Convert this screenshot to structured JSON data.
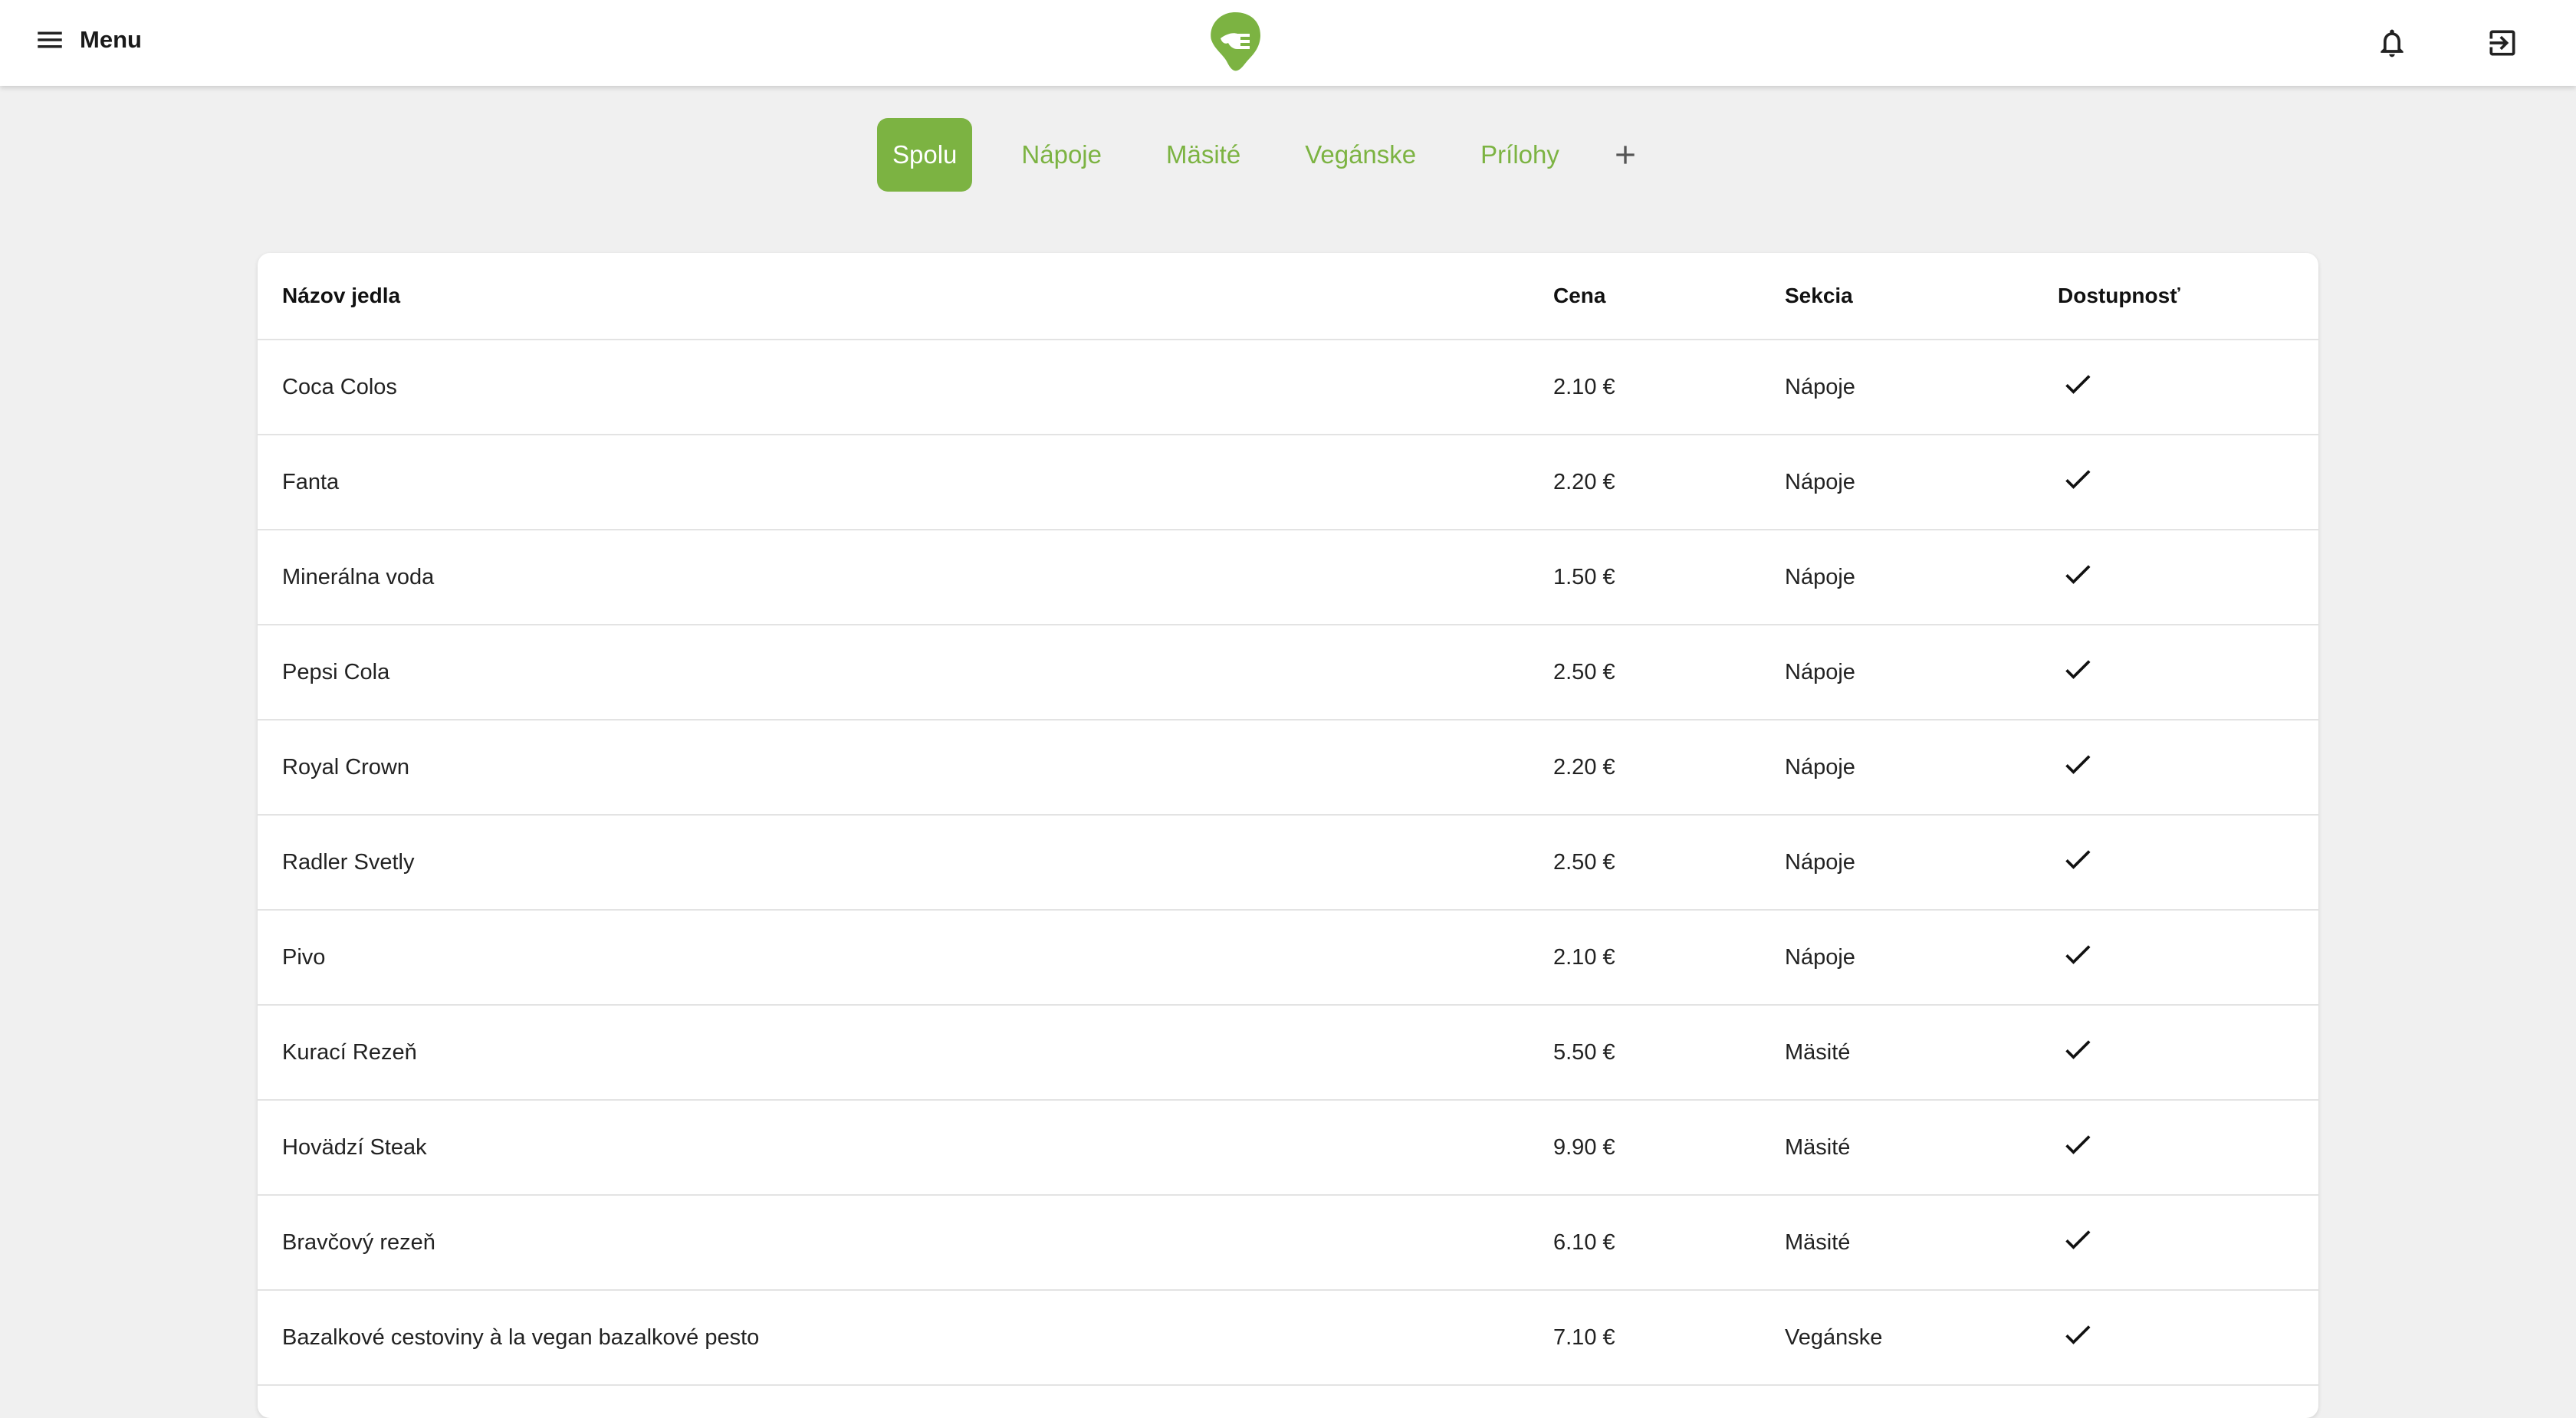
{
  "header": {
    "menu_label": "Menu",
    "icons": [
      "menu-icon",
      "logo-icon",
      "bell-icon",
      "logout-icon"
    ]
  },
  "colors": {
    "accent": "#7cb342",
    "background": "#f0f0f0",
    "surface": "#ffffff",
    "text": "#1a1a1a"
  },
  "tabs": [
    {
      "label": "Spolu",
      "active": true
    },
    {
      "label": "Nápoje",
      "active": false
    },
    {
      "label": "Mäsité",
      "active": false
    },
    {
      "label": "Vegánske",
      "active": false
    },
    {
      "label": "Prílohy",
      "active": false
    }
  ],
  "table": {
    "columns": [
      "Názov jedla",
      "Cena",
      "Sekcia",
      "Dostupnosť"
    ],
    "rows": [
      {
        "name": "Coca Colos",
        "price": "2.10 €",
        "section": "Nápoje",
        "available": true
      },
      {
        "name": "Fanta",
        "price": "2.20 €",
        "section": "Nápoje",
        "available": true
      },
      {
        "name": "Minerálna voda",
        "price": "1.50 €",
        "section": "Nápoje",
        "available": true
      },
      {
        "name": "Pepsi Cola",
        "price": "2.50 €",
        "section": "Nápoje",
        "available": true
      },
      {
        "name": "Royal Crown",
        "price": "2.20 €",
        "section": "Nápoje",
        "available": true
      },
      {
        "name": "Radler Svetly",
        "price": "2.50 €",
        "section": "Nápoje",
        "available": true
      },
      {
        "name": "Pivo",
        "price": "2.10 €",
        "section": "Nápoje",
        "available": true
      },
      {
        "name": "Kurací Rezeň",
        "price": "5.50 €",
        "section": "Mäsité",
        "available": true
      },
      {
        "name": "Hovädzí Steak",
        "price": "9.90 €",
        "section": "Mäsité",
        "available": true
      },
      {
        "name": "Bravčový rezeň",
        "price": "6.10 €",
        "section": "Mäsité",
        "available": true
      },
      {
        "name": "Bazalkové cestoviny à la vegan bazalkové pesto",
        "price": "7.10 €",
        "section": "Vegánske",
        "available": true
      }
    ]
  }
}
